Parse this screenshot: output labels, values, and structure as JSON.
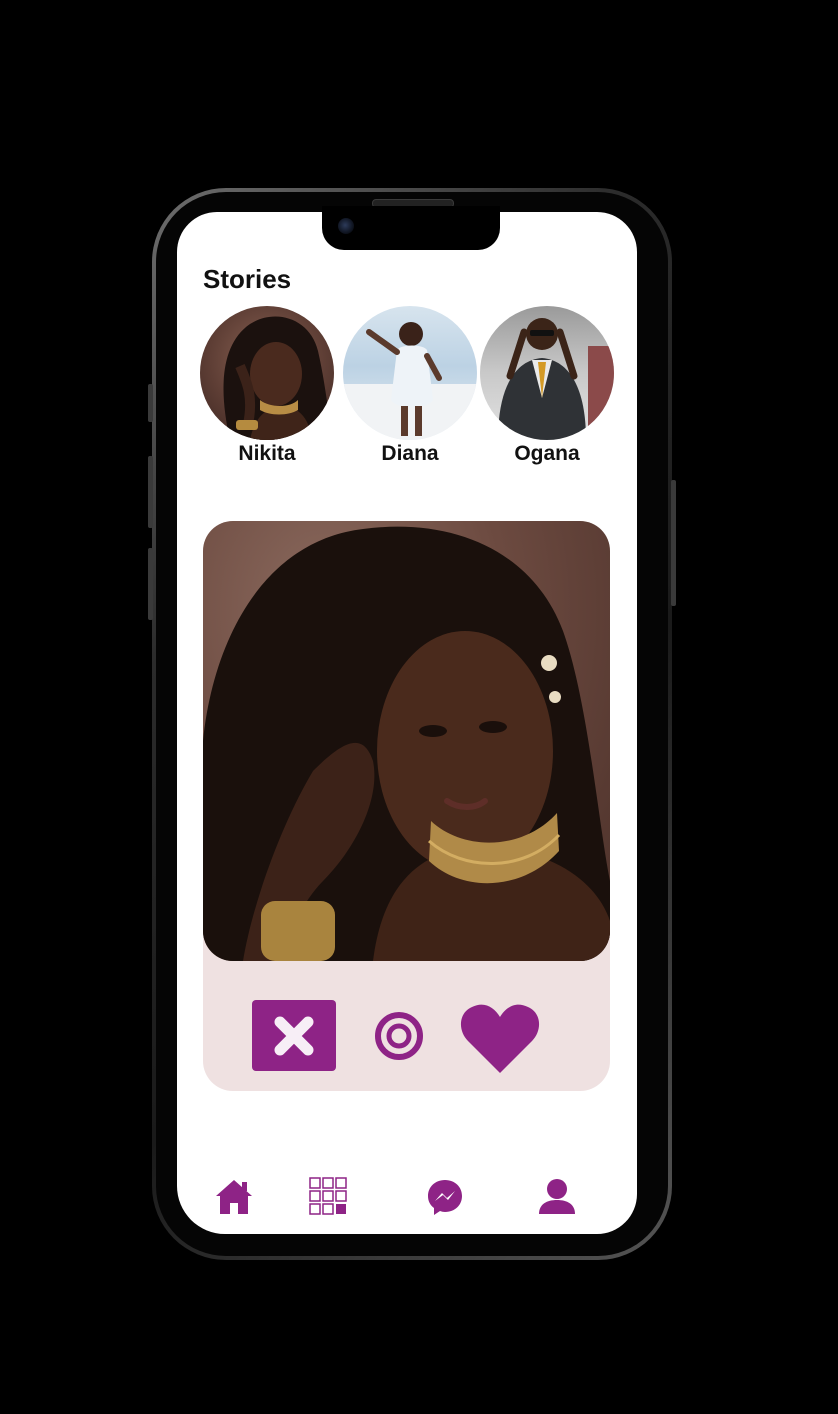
{
  "stories": {
    "title": "Stories",
    "items": [
      {
        "name": "Nikita"
      },
      {
        "name": "Diana"
      },
      {
        "name": "Ogana"
      }
    ]
  },
  "card": {
    "actions": {
      "dislike": "close-icon",
      "super": "target-icon",
      "like": "heart-icon"
    }
  },
  "bottom_nav": {
    "items": [
      "home-icon",
      "grid-icon",
      "messenger-icon",
      "profile-icon"
    ]
  },
  "colors": {
    "accent": "#8e2386",
    "card_bg": "#efe1e1",
    "background": "#000000",
    "screen": "#ffffff"
  }
}
